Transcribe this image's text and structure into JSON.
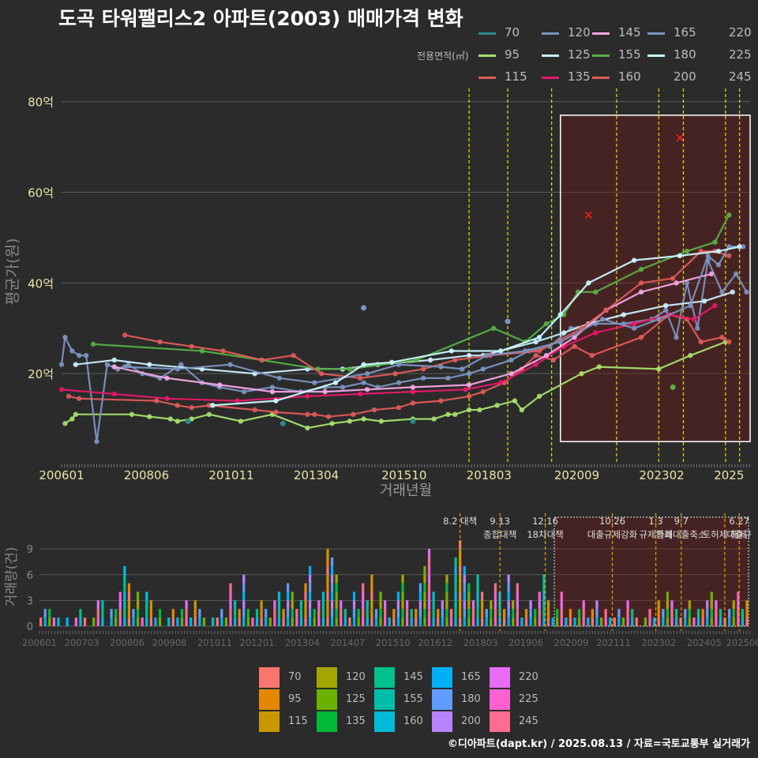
{
  "title": "도곡 타워팰리스2 아파트(2003) 매매가격 변화",
  "legend_top": {
    "label": "전용면적(㎡)",
    "items": [
      {
        "name": "70",
        "color": "#2a8a8a"
      },
      {
        "name": "120",
        "color": "#7b93c0"
      },
      {
        "name": "145",
        "color": "#f4a6e6"
      },
      {
        "name": "165",
        "color": "#7b93c0"
      },
      {
        "name": "220",
        "color": ""
      },
      {
        "name": "95",
        "color": "#a6e06e"
      },
      {
        "name": "125",
        "color": "#c9efff"
      },
      {
        "name": "155",
        "color": "#55b043"
      },
      {
        "name": "180",
        "color": "#c9f7ff"
      },
      {
        "name": "225",
        "color": ""
      },
      {
        "name": "115",
        "color": "#e05a5a"
      },
      {
        "name": "135",
        "color": "#e8176a"
      },
      {
        "name": "160",
        "color": "#e05a5a"
      },
      {
        "name": "200",
        "color": ""
      },
      {
        "name": "245",
        "color": ""
      }
    ]
  },
  "chart_data": [
    {
      "type": "line",
      "ylabel": "평균가(원)",
      "xlabel": "거래년월",
      "yticks": [
        "20억",
        "40억",
        "60억",
        "80억"
      ],
      "ytick_values": [
        20,
        40,
        60,
        80
      ],
      "ylim": [
        0,
        85
      ],
      "xticks": [
        "200601",
        "200806",
        "201011",
        "201304",
        "201510",
        "201803",
        "202009",
        "202302",
        "2025"
      ],
      "xlim": [
        2006.0,
        2025.6
      ],
      "series": [
        {
          "name": "95",
          "color": "#a6e06e",
          "x": [
            2006.1,
            2006.3,
            2006.4,
            2008.0,
            2008.5,
            2009.1,
            2009.3,
            2009.7,
            2010.2,
            2011.1,
            2012.0,
            2013.0,
            2013.7,
            2014.2,
            2014.6,
            2015.1,
            2016.0,
            2016.6,
            2017.0,
            2017.2,
            2017.6,
            2017.9,
            2018.4,
            2018.9,
            2019.1,
            2019.6,
            2020.8,
            2021.3,
            2023.0,
            2023.9,
            2024.9
          ],
          "y": [
            9,
            10,
            11,
            11,
            10.5,
            10,
            9.5,
            10,
            11,
            9.5,
            11,
            8,
            9,
            9.5,
            10,
            9.5,
            10,
            10,
            11,
            11,
            12,
            12,
            13,
            14,
            12,
            15,
            20,
            21.5,
            21,
            24,
            27
          ]
        },
        {
          "name": "115",
          "color": "#e05a5a",
          "x": [
            2006.2,
            2006.5,
            2008.7,
            2009.3,
            2009.7,
            2010.2,
            2011.5,
            2012.1,
            2013.0,
            2013.2,
            2013.6,
            2014.3,
            2014.9,
            2015.6,
            2016.0,
            2016.8,
            2017.6,
            2018.0,
            2018.6,
            2019.1,
            2019.5,
            2020.0,
            2020.6,
            2021.1,
            2022.5,
            2023.3,
            2023.8,
            2024.2,
            2024.8,
            2025.0
          ],
          "y": [
            15,
            14.5,
            14,
            13,
            12.5,
            13,
            12,
            11.5,
            11,
            11,
            10.5,
            11,
            12,
            12.5,
            13.5,
            14,
            15,
            16,
            18,
            21,
            24,
            23,
            26,
            24,
            28,
            33,
            32,
            27,
            28,
            27
          ]
        },
        {
          "name": "120",
          "color": "#7b93c0",
          "x": [
            2006.0,
            2006.1,
            2006.3,
            2006.5,
            2006.7,
            2007.0,
            2007.3,
            2007.6,
            2007.9,
            2008.3,
            2008.8,
            2009.4,
            2010.0,
            2010.5,
            2011.2,
            2012.0,
            2012.8,
            2013.5,
            2014.0,
            2014.6,
            2015.0,
            2015.6,
            2016.3,
            2017.0,
            2017.6,
            2018.0,
            2018.8,
            2019.3,
            2019.9,
            2020.5,
            2021.2,
            2022.0,
            2022.8,
            2023.2,
            2023.5,
            2023.8,
            2024.1,
            2024.4,
            2024.8,
            2025.2,
            2025.5
          ],
          "y": [
            22,
            28,
            25,
            24,
            24,
            5,
            22,
            21,
            22,
            20,
            19,
            22,
            18,
            17,
            16,
            17,
            16,
            17,
            17,
            18,
            17,
            18,
            19,
            19,
            20,
            21,
            23,
            25,
            26,
            30,
            31,
            31,
            32,
            34,
            28,
            40,
            30,
            45,
            38,
            42,
            38
          ]
        },
        {
          "name": "125",
          "color": "#c9efff",
          "x": [
            2006.4,
            2007.5,
            2008.5,
            2010.0,
            2011.5,
            2013.0,
            2014.0,
            2015.0,
            2016.5,
            2017.6,
            2018.0,
            2019.5,
            2020.3,
            2021.0,
            2022.0,
            2023.2,
            2024.3,
            2025.1
          ],
          "y": [
            22,
            23,
            22,
            21,
            20,
            21,
            21,
            22,
            23,
            24,
            24,
            27,
            29,
            31,
            33,
            35,
            36,
            38
          ]
        },
        {
          "name": "135",
          "color": "#e8176a",
          "x": [
            2006.0,
            2007.5,
            2009.0,
            2011.0,
            2013.0,
            2014.5,
            2016.0,
            2017.5,
            2018.5,
            2019.5,
            2020.3,
            2021.2,
            2022.3,
            2023.3,
            2024.0,
            2024.6
          ],
          "y": [
            16.5,
            15.5,
            14.5,
            14,
            15,
            15.5,
            16,
            16.5,
            18,
            22,
            26,
            29,
            31,
            33,
            32,
            35
          ]
        },
        {
          "name": "145",
          "color": "#f4a6e6",
          "x": [
            2007.5,
            2009.0,
            2010.5,
            2012.0,
            2013.5,
            2014.7,
            2016.0,
            2017.6,
            2018.8,
            2019.8,
            2020.6,
            2021.5,
            2022.5,
            2023.5,
            2024.5
          ],
          "y": [
            21.5,
            19,
            17.5,
            16,
            16,
            16.5,
            17,
            17.5,
            20,
            24,
            28,
            34,
            38,
            40,
            42
          ]
        },
        {
          "name": "155",
          "color": "#55b043",
          "x": [
            2006.9,
            2010.0,
            2011.7,
            2013.3,
            2014.2,
            2016.1,
            2018.3,
            2019.2,
            2019.8,
            2020.3,
            2020.7,
            2021.2,
            2022.5,
            2023.8,
            2024.6,
            2025.0
          ],
          "y": [
            26.5,
            25,
            23,
            21,
            21,
            23,
            30,
            27,
            31,
            33,
            38,
            38,
            43,
            47,
            49,
            55
          ]
        },
        {
          "name": "160",
          "color": "#e05a5a",
          "x": [
            2007.8,
            2008.8,
            2009.7,
            2010.6,
            2011.7,
            2012.6,
            2013.4,
            2014.5,
            2015.5,
            2016.3,
            2017.2,
            2018.2,
            2019.6,
            2020.8,
            2021.5,
            2022.5,
            2023.4,
            2024.2,
            2024.6,
            2025.0
          ],
          "y": [
            28.5,
            27,
            26,
            25,
            23,
            24,
            20,
            19,
            20,
            21,
            23,
            24,
            25,
            30,
            34,
            40,
            41,
            47,
            47,
            46
          ]
        },
        {
          "name": "165",
          "color": "#7b93c0",
          "x": [
            2007.8,
            2009.3,
            2010.8,
            2012.2,
            2013.2,
            2014.7,
            2015.6,
            2016.8,
            2017.4,
            2018.1,
            2019.2,
            2020.2,
            2021.4,
            2022.3,
            2023.0,
            2023.9,
            2024.4,
            2024.7,
            2025.0,
            2025.4
          ],
          "y": [
            21.5,
            21,
            22,
            19,
            18,
            20,
            22,
            21.5,
            21,
            24,
            25,
            27,
            32,
            30,
            32,
            35,
            46,
            44,
            48,
            48
          ]
        },
        {
          "name": "180",
          "color": "#c9f7ff",
          "x": [
            2010.3,
            2012.1,
            2013.8,
            2014.6,
            2015.4,
            2017.1,
            2018.5,
            2019.6,
            2020.2,
            2021.0,
            2022.3,
            2023.6,
            2024.7,
            2025.3
          ],
          "y": [
            13,
            14,
            18,
            22,
            22.5,
            25,
            25,
            28,
            33,
            40,
            45,
            46,
            47,
            48
          ]
        }
      ],
      "scatter_points": [
        {
          "x": 2014.6,
          "y": 34.5,
          "color": "#7b93c0"
        },
        {
          "x": 2018.7,
          "y": 31.5,
          "color": "#7b93c0"
        },
        {
          "x": 2023.4,
          "y": 17,
          "color": "#55b043"
        },
        {
          "x": 2009.6,
          "y": 9.5,
          "color": "#2a8a8a"
        },
        {
          "x": 2012.3,
          "y": 9,
          "color": "#2a8a8a"
        },
        {
          "x": 2016.0,
          "y": 9.5,
          "color": "#2a8a8a"
        }
      ],
      "x_markers": [
        {
          "x": 2021.0,
          "y": 55
        },
        {
          "x": 2023.6,
          "y": 72
        }
      ],
      "vlines": [
        2017.6,
        2018.7,
        2019.95,
        2021.8,
        2023.0,
        2023.7,
        2024.9,
        2025.3
      ],
      "highlight_region": {
        "x0": 2020.2,
        "x1": 2025.6,
        "y0": 5,
        "y1": 77
      }
    },
    {
      "type": "bar",
      "ylabel": "거래량(건)",
      "yticks": [
        "0",
        "3",
        "6",
        "9"
      ],
      "ytick_values": [
        0,
        3,
        6,
        9
      ],
      "ylim": [
        0,
        11.5
      ],
      "xticks": [
        "200601",
        "200703",
        "200806",
        "200908",
        "201011",
        "201201",
        "201304",
        "201407",
        "201510",
        "201612",
        "201803",
        "201906",
        "202009",
        "202111",
        "202302",
        "202405",
        "202506"
      ],
      "annotations": [
        {
          "x": 2017.6,
          "lines": [
            "8.2 대책"
          ]
        },
        {
          "x": 2018.7,
          "lines": [
            "9.13",
            "종합대책"
          ]
        },
        {
          "x": 2019.95,
          "lines": [
            "12.16",
            "18차대책"
          ]
        },
        {
          "x": 2021.8,
          "lines": [
            "10.26",
            "대출규제강화"
          ]
        },
        {
          "x": 2023.0,
          "lines": [
            "1.3",
            "규제완화"
          ]
        },
        {
          "x": 2023.7,
          "lines": [
            "9.7",
            "특례대출축소"
          ]
        },
        {
          "x": 2024.9,
          "lines": [
            "",
            "토허제 해제"
          ]
        },
        {
          "x": 2025.3,
          "lines": [
            "6.27",
            "대출규"
          ]
        }
      ],
      "monthly_counts": [
        1,
        2,
        2,
        1,
        1,
        0,
        1,
        0,
        1,
        2,
        1,
        0,
        1,
        3,
        3,
        0,
        2,
        2,
        4,
        7,
        5,
        2,
        4,
        1,
        4,
        3,
        1,
        2,
        0,
        1,
        2,
        1,
        2,
        3,
        1,
        3,
        2,
        1,
        0,
        1,
        1,
        2,
        1,
        5,
        3,
        2,
        6,
        2,
        1,
        2,
        3,
        2,
        1,
        3,
        4,
        2,
        5,
        4,
        2,
        3,
        5,
        7,
        2,
        3,
        4,
        9,
        8,
        6,
        3,
        2,
        1,
        4,
        2,
        5,
        3,
        6,
        2,
        4,
        3,
        1,
        2,
        4,
        6,
        3,
        2,
        2,
        5,
        7,
        9,
        4,
        2,
        3,
        6,
        2,
        8,
        10,
        7,
        5,
        3,
        6,
        4,
        2,
        3,
        5,
        4,
        2,
        6,
        3,
        5,
        1,
        2,
        3,
        2,
        4,
        6,
        3,
        1,
        2,
        4,
        1,
        2,
        1,
        2,
        3,
        1,
        2,
        3,
        1,
        2,
        1,
        1,
        2,
        1,
        3,
        2,
        1,
        0,
        1,
        2,
        1,
        3,
        2,
        4,
        3,
        2,
        1,
        2,
        3,
        1,
        2,
        2,
        3,
        4,
        3,
        2,
        1,
        2,
        3,
        4,
        2,
        3
      ],
      "legend": [
        {
          "name": "70",
          "color": "#f8766d"
        },
        {
          "name": "120",
          "color": "#a3a500"
        },
        {
          "name": "145",
          "color": "#00c08b"
        },
        {
          "name": "165",
          "color": "#00b0f6"
        },
        {
          "name": "220",
          "color": "#e76bf3"
        },
        {
          "name": "95",
          "color": "#e58700"
        },
        {
          "name": "125",
          "color": "#6bb100"
        },
        {
          "name": "155",
          "color": "#00bfa8"
        },
        {
          "name": "180",
          "color": "#619cff"
        },
        {
          "name": "225",
          "color": "#fd61d1"
        },
        {
          "name": "115",
          "color": "#c99800"
        },
        {
          "name": "135",
          "color": "#00ba38"
        },
        {
          "name": "160",
          "color": "#00bcd8"
        },
        {
          "name": "200",
          "color": "#b983ff"
        },
        {
          "name": "245",
          "color": "#ff6c91"
        }
      ]
    }
  ],
  "footer": "©디아파트(dapt.kr) / 2025.08.13 / 자료=국토교통부 실거래가"
}
